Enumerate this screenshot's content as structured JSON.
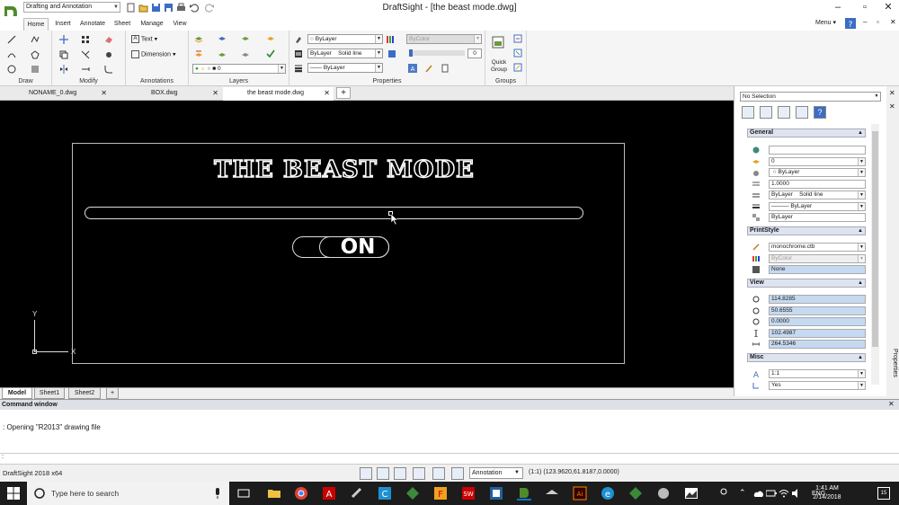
{
  "titlebar": {
    "workspace": "Drafting and Annotation",
    "title": "DraftSight - [the beast mode.dwg]"
  },
  "ribbon_tabs": [
    "Home",
    "Insert",
    "Annotate",
    "Sheet",
    "Manage",
    "View"
  ],
  "menu_label": "Menu",
  "ribbon": {
    "groups": {
      "draw": "Draw",
      "modify": "Modify",
      "annotations": "Annotations",
      "layers": "Layers",
      "properties": "Properties",
      "groups": "Groups"
    },
    "text_btn": "Text",
    "dimension_btn": "Dimension",
    "layer_value": "0",
    "color_value": "ByLayer",
    "linestyle_value": "ByLayer",
    "linestyle_name": "Solid line",
    "lineweight_value": "ByLayer",
    "printstyle_value": "ByColor",
    "transparency_value": "0",
    "quick_group": "Quick Group"
  },
  "doc_tabs": [
    "NONAME_0.dwg",
    "BOX.dwg",
    "the beast mode.dwg"
  ],
  "canvas": {
    "title": "THE BEAST MODE",
    "toggle": "ON",
    "ucs_x": "X",
    "ucs_y": "Y"
  },
  "sheet_tabs": [
    "Model",
    "Sheet1",
    "Sheet2",
    "+"
  ],
  "properties": {
    "selection": "No Selection",
    "general_header": "General",
    "general": [
      "",
      "0",
      "ByLayer",
      "1.0000",
      "ByLayer",
      "Solid line",
      "ByLayer",
      "ByLayer"
    ],
    "printstyle_header": "PrintStyle",
    "printstyle": [
      "monochrome.ctb",
      "ByColor",
      "None"
    ],
    "view_header": "View",
    "view": [
      "114.8285",
      "50.6555",
      "0.0000",
      "102.4987",
      "264.5346"
    ],
    "misc_header": "Misc",
    "misc": [
      "1:1",
      "Yes"
    ],
    "panel_label": "Properties"
  },
  "command": {
    "header": "Command window",
    "history": ": Opening \"R2013\" drawing file",
    "prompt": ":"
  },
  "status": {
    "app": "DraftSight 2018 x64",
    "annotation": "Annotation",
    "scale": "(1:1)",
    "coords": "(123.9620,61.8187,0.0000)"
  },
  "taskbar": {
    "search_placeholder": "Type here to search",
    "lang": "ENG",
    "time": "1:41 AM",
    "date": "2/14/2018",
    "notif_count": "15"
  },
  "colors": {
    "accent": "#0078d7",
    "canvas": "#000000",
    "selected_field": "#c5d9f1"
  }
}
